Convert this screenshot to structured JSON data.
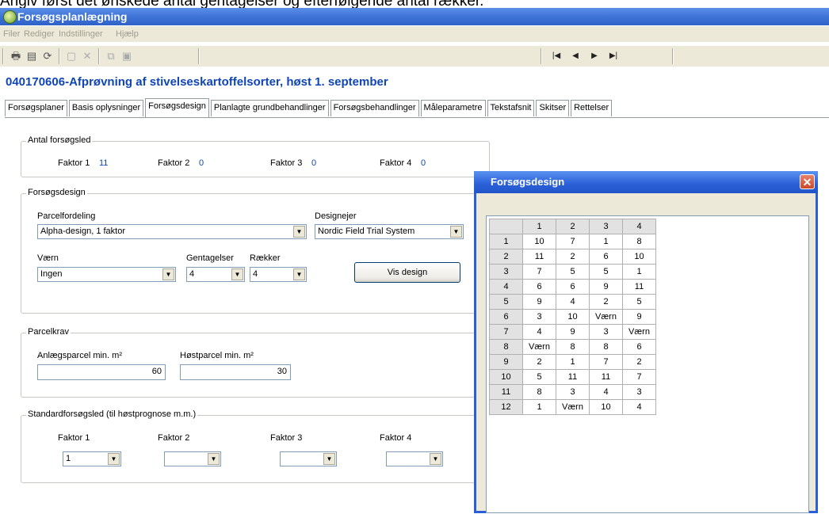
{
  "caption": "Angiv først det ønskede antal gentagelser og efterfølgende antal rækker.",
  "window": {
    "title": "Forsøgsplanlægning"
  },
  "menu": [
    "Filer",
    "Rediger",
    "Indstillinger",
    "Hjælp"
  ],
  "trial_title": "040170606-Afprøvning af stivelseskartoffelsorter, høst 1. september",
  "tabs": [
    {
      "label": "Forsøgsplaner"
    },
    {
      "label": "Basis oplysninger"
    },
    {
      "label": "Forsøgsdesign"
    },
    {
      "label": "Planlagte grundbehandlinger"
    },
    {
      "label": "Forsøgsbehandlinger"
    },
    {
      "label": "Måleparametre"
    },
    {
      "label": "Tekstafsnit"
    },
    {
      "label": "Skitser"
    },
    {
      "label": "Rettelser"
    }
  ],
  "antal": {
    "title": "Antal forsøgsled",
    "factors": [
      {
        "label": "Faktor 1",
        "value": "11"
      },
      {
        "label": "Faktor 2",
        "value": "0"
      },
      {
        "label": "Faktor 3",
        "value": "0"
      },
      {
        "label": "Faktor 4",
        "value": "0"
      }
    ]
  },
  "design": {
    "title": "Forsøgsdesign",
    "parcel_label": "Parcelfordeling",
    "parcel_value": "Alpha-design, 1 faktor",
    "owner_label": "Designejer",
    "owner_value": "Nordic Field Trial System",
    "vaern_label": "Værn",
    "vaern_value": "Ingen",
    "gent_label": "Gentagelser",
    "gent_value": "4",
    "rows_label": "Rækker",
    "rows_value": "4",
    "show_button": "Vis design"
  },
  "parcelkrav": {
    "title": "Parcelkrav",
    "anlaeg_label": "Anlægsparcel min. m²",
    "anlaeg_value": "60",
    "hoest_label": "Høstparcel min. m²",
    "hoest_value": "30"
  },
  "standard": {
    "title": "Standardforsøgsled (til høstprognose m.m.)",
    "factors": [
      {
        "label": "Faktor 1",
        "value": "1"
      },
      {
        "label": "Faktor 2",
        "value": ""
      },
      {
        "label": "Faktor 3",
        "value": ""
      },
      {
        "label": "Faktor 4",
        "value": ""
      }
    ]
  },
  "dialog": {
    "title": "Forsøgsdesign",
    "columns": [
      "",
      "1",
      "2",
      "3",
      "4"
    ],
    "rows": [
      [
        "1",
        "10",
        "7",
        "1",
        "8"
      ],
      [
        "2",
        "11",
        "2",
        "6",
        "10"
      ],
      [
        "3",
        "7",
        "5",
        "5",
        "1"
      ],
      [
        "4",
        "6",
        "6",
        "9",
        "11"
      ],
      [
        "5",
        "9",
        "4",
        "2",
        "5"
      ],
      [
        "6",
        "3",
        "10",
        "Værn",
        "9"
      ],
      [
        "7",
        "4",
        "9",
        "3",
        "Værn"
      ],
      [
        "8",
        "Værn",
        "8",
        "8",
        "6"
      ],
      [
        "9",
        "2",
        "1",
        "7",
        "2"
      ],
      [
        "10",
        "5",
        "11",
        "11",
        "7"
      ],
      [
        "11",
        "8",
        "3",
        "4",
        "3"
      ],
      [
        "12",
        "1",
        "Værn",
        "10",
        "4"
      ]
    ]
  }
}
